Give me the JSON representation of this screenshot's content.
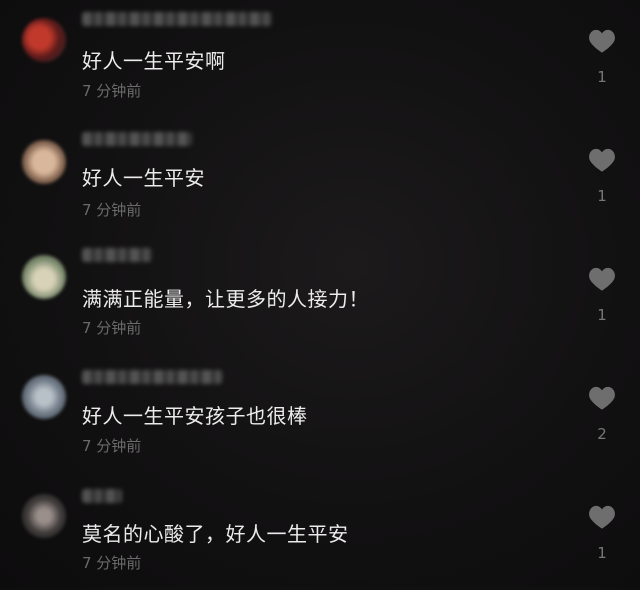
{
  "comments": [
    {
      "username": "",
      "content": "好人一生平安啊",
      "time": "7 分钟前",
      "likes": "1",
      "avatar_color": "#7a2323"
    },
    {
      "username": "",
      "content": "好人一生平安",
      "time": "7 分钟前",
      "likes": "1",
      "avatar_color": "#8a6a55"
    },
    {
      "username": "",
      "content": "满满正能量，让更多的人接力！",
      "time": "7 分钟前",
      "likes": "1",
      "avatar_color": "#7d8c6f"
    },
    {
      "username": "",
      "content": "好人一生平安孩子也很棒",
      "time": "7 分钟前",
      "likes": "2",
      "avatar_color": "#6f7a86"
    },
    {
      "username": "",
      "content": "莫名的心酸了，好人一生平安",
      "time": "7 分钟前",
      "likes": "1",
      "avatar_color": "#3e3a3a"
    }
  ],
  "icons": {
    "like": "heart-icon"
  },
  "colors": {
    "background": "#121112",
    "text": "#ececec",
    "muted": "#6a6a6a",
    "like_icon": "#6e6e6e"
  }
}
